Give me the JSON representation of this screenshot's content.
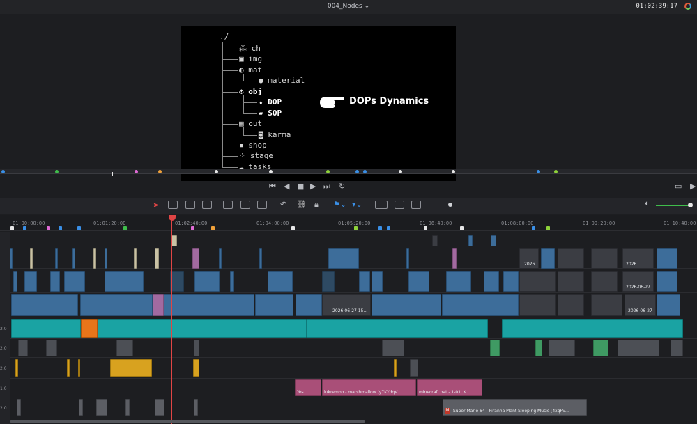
{
  "topbar": {
    "project": "004_Nodes ⌄",
    "timecode": "01:02:39:17"
  },
  "viewer": {
    "root": "./",
    "items": [
      {
        "icon": "⁂",
        "label": "ch"
      },
      {
        "icon": "▣",
        "label": "img"
      },
      {
        "icon": "◐",
        "label": "mat"
      },
      {
        "icon": "●",
        "label": "material"
      },
      {
        "icon": "⚙",
        "label": "obj"
      },
      {
        "icon": "★",
        "label": "DOP"
      },
      {
        "icon": "▰",
        "label": "SOP"
      },
      {
        "icon": "▦",
        "label": "out"
      },
      {
        "icon": "◙",
        "label": "karma"
      },
      {
        "icon": "▪",
        "label": "shop"
      },
      {
        "icon": "⁘",
        "label": "stage"
      },
      {
        "icon": "☁",
        "label": "tasks"
      }
    ],
    "callout_title": "DOPs Dynamics"
  },
  "ruler": {
    "labels": [
      "01:00:00:00",
      "01:01:20:00",
      "01:02:40:00",
      "01:04:00:00",
      "01:05:20:00",
      "01:06:40:00",
      "01:08:00:00",
      "01:09:20:00",
      "01:10:40:00"
    ]
  },
  "tracks": {
    "labels": [
      "2.0",
      "2.0",
      "2.0",
      "1.0",
      "2.0"
    ],
    "clip_labels": {
      "v1_a": "2026-06-27 15...",
      "v1_b": "2026-06-27",
      "v1_c": "2026...",
      "v2_a": "2026-06-27",
      "v3_a": "2026...",
      "p1": "Yos...",
      "p2": "lukrembo - marshmallow [y7KYdqV...",
      "p3": "minecraft oat - 1-01. K...",
      "g1": "Super Mario 64 - Piranha Plant Sleeping Music [4xqFV..."
    }
  }
}
